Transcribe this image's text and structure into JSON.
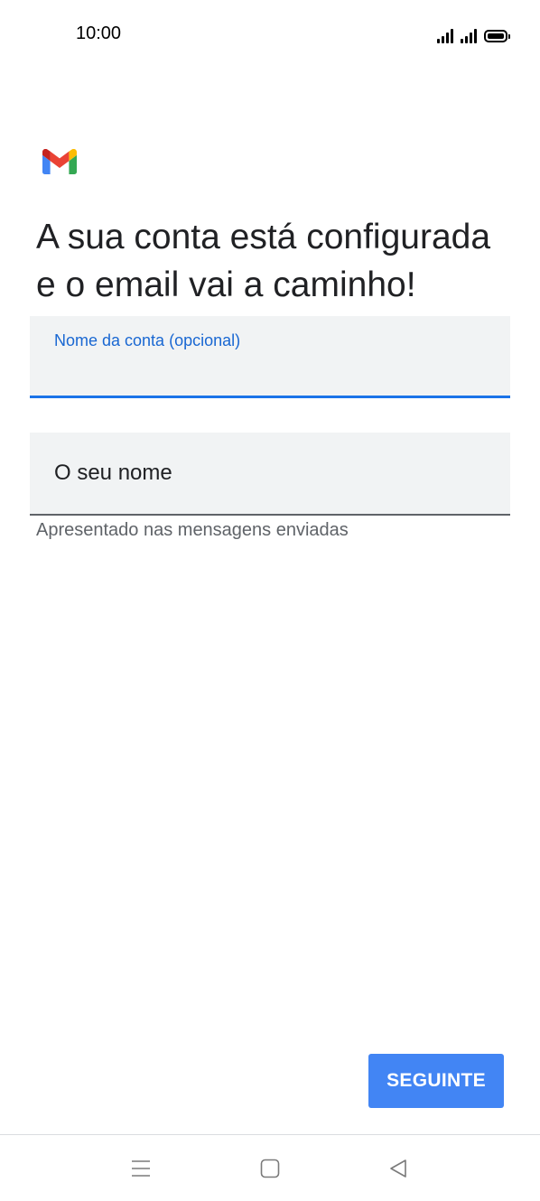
{
  "status_bar": {
    "time": "10:00",
    "icons": [
      "signal-icon",
      "signal-icon",
      "battery-icon"
    ]
  },
  "app": {
    "logo": "gmail-logo-icon",
    "colors": {
      "accent": "#1a73e8",
      "button": "#4285f4",
      "field_bg": "#f1f3f4"
    }
  },
  "heading": "A sua conta está configurada e o email vai a caminho!",
  "account_name_field": {
    "label": "Nome da conta (opcional)",
    "value": ""
  },
  "your_name_field": {
    "placeholder": "O seu nome",
    "value": "",
    "helper": "Apresentado nas mensagens enviadas"
  },
  "next_button": {
    "label": "SEGUINTE"
  },
  "nav_bar": {
    "icons": [
      "menu-icon",
      "home-icon",
      "back-icon"
    ]
  }
}
